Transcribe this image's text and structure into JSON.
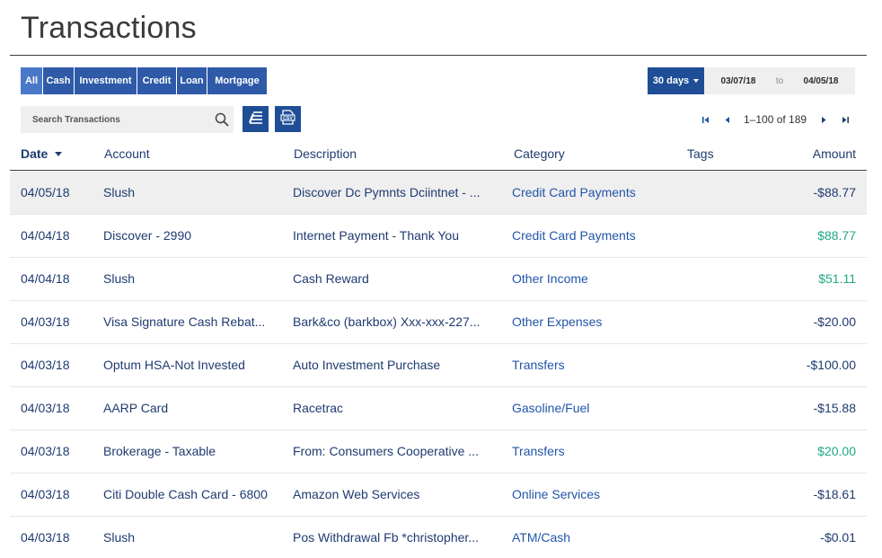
{
  "page": {
    "title": "Transactions"
  },
  "filters": [
    {
      "label": "All",
      "active": true
    },
    {
      "label": "Cash",
      "active": false
    },
    {
      "label": "Investment",
      "active": false
    },
    {
      "label": "Credit",
      "active": false
    },
    {
      "label": "Loan",
      "active": false
    },
    {
      "label": "Mortgage",
      "active": false
    }
  ],
  "date_range": {
    "preset": "30 days",
    "from": "03/07/18",
    "to_label": "to",
    "to": "04/05/18"
  },
  "search": {
    "placeholder": "Search Transactions",
    "value": ""
  },
  "tools": {
    "edit_icon": "edit-list-icon",
    "export_icon": "csv-export-icon"
  },
  "pagination": {
    "range_text": "1–100 of 189"
  },
  "table": {
    "columns": {
      "date": "Date",
      "account": "Account",
      "description": "Description",
      "category": "Category",
      "tags": "Tags",
      "amount": "Amount"
    },
    "rows": [
      {
        "date": "04/05/18",
        "account": "Slush",
        "description": "Discover Dc Pymnts Dciintnet - ...",
        "category": "Credit Card Payments",
        "tags": "",
        "amount": "-$88.77",
        "positive": false
      },
      {
        "date": "04/04/18",
        "account": "Discover - 2990",
        "description": "Internet Payment - Thank You",
        "category": "Credit Card Payments",
        "tags": "",
        "amount": "$88.77",
        "positive": true
      },
      {
        "date": "04/04/18",
        "account": "Slush",
        "description": "Cash Reward",
        "category": "Other Income",
        "tags": "",
        "amount": "$51.11",
        "positive": true
      },
      {
        "date": "04/03/18",
        "account": "Visa Signature Cash Rebat...",
        "description": "Bark&co (barkbox) Xxx-xxx-227...",
        "category": "Other Expenses",
        "tags": "",
        "amount": "-$20.00",
        "positive": false
      },
      {
        "date": "04/03/18",
        "account": "Optum HSA-Not Invested",
        "description": "Auto Investment Purchase",
        "category": "Transfers",
        "tags": "",
        "amount": "-$100.00",
        "positive": false
      },
      {
        "date": "04/03/18",
        "account": "AARP Card",
        "description": "Racetrac",
        "category": "Gasoline/Fuel",
        "tags": "",
        "amount": "-$15.88",
        "positive": false
      },
      {
        "date": "04/03/18",
        "account": "Brokerage - Taxable",
        "description": "From: Consumers Cooperative ...",
        "category": "Transfers",
        "tags": "",
        "amount": "$20.00",
        "positive": true
      },
      {
        "date": "04/03/18",
        "account": "Citi Double Cash Card - 6800",
        "description": "Amazon Web Services",
        "category": "Online Services",
        "tags": "",
        "amount": "-$18.61",
        "positive": false
      },
      {
        "date": "04/03/18",
        "account": "Slush",
        "description": "Pos Withdrawal Fb *christopher...",
        "category": "ATM/Cash",
        "tags": "",
        "amount": "-$0.01",
        "positive": false
      }
    ]
  }
}
